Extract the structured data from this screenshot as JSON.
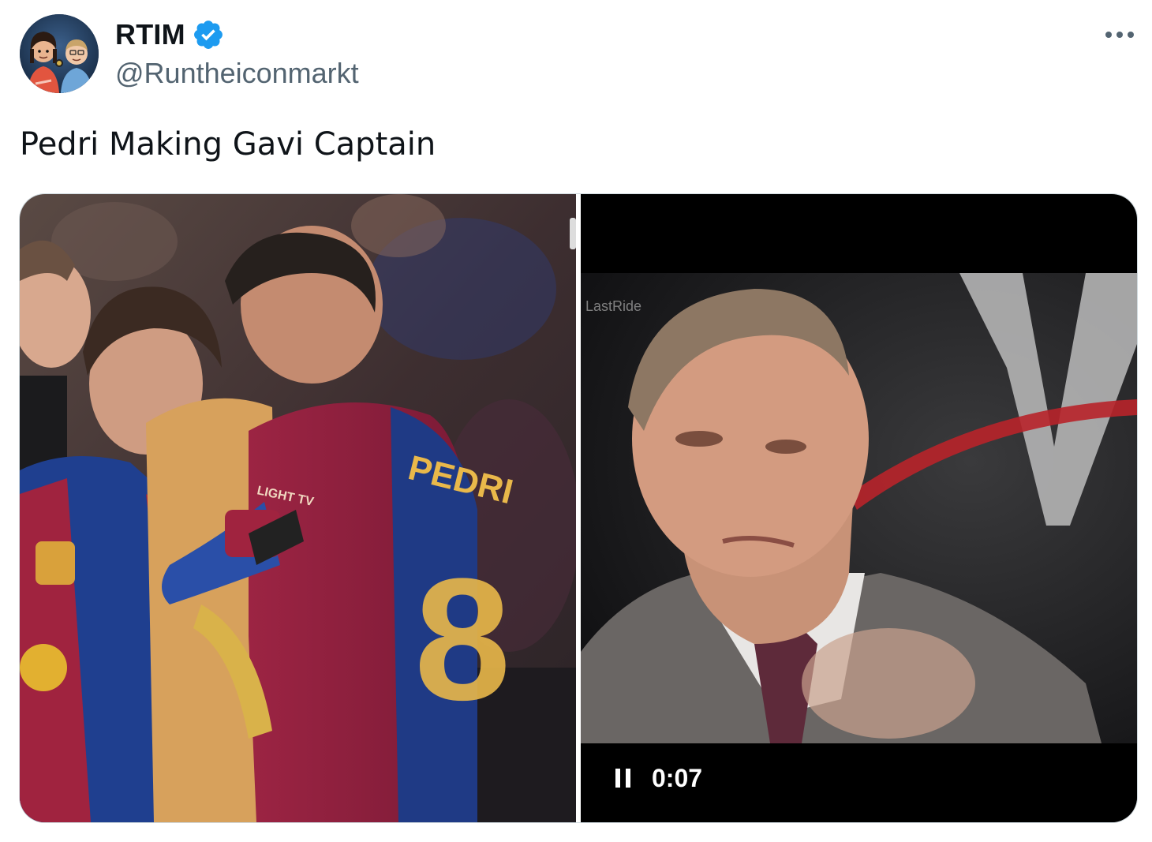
{
  "tweet": {
    "display_name": "RTIM",
    "handle": "@Runtheiconmarkt",
    "text": "Pedri Making Gavi Captain",
    "verified": true,
    "accent_color": "#1d9bf0"
  },
  "media": {
    "left_image": {
      "jersey_name": "PEDRI",
      "jersey_number": "8",
      "sleeve_text": "LIGHT TV"
    },
    "right_video": {
      "watermark": "LastRide",
      "timestamp": "0:07",
      "state": "playing"
    }
  },
  "icons": {
    "more": "more-horizontal-icon",
    "verified": "verified-badge-icon",
    "pause": "pause-icon"
  }
}
